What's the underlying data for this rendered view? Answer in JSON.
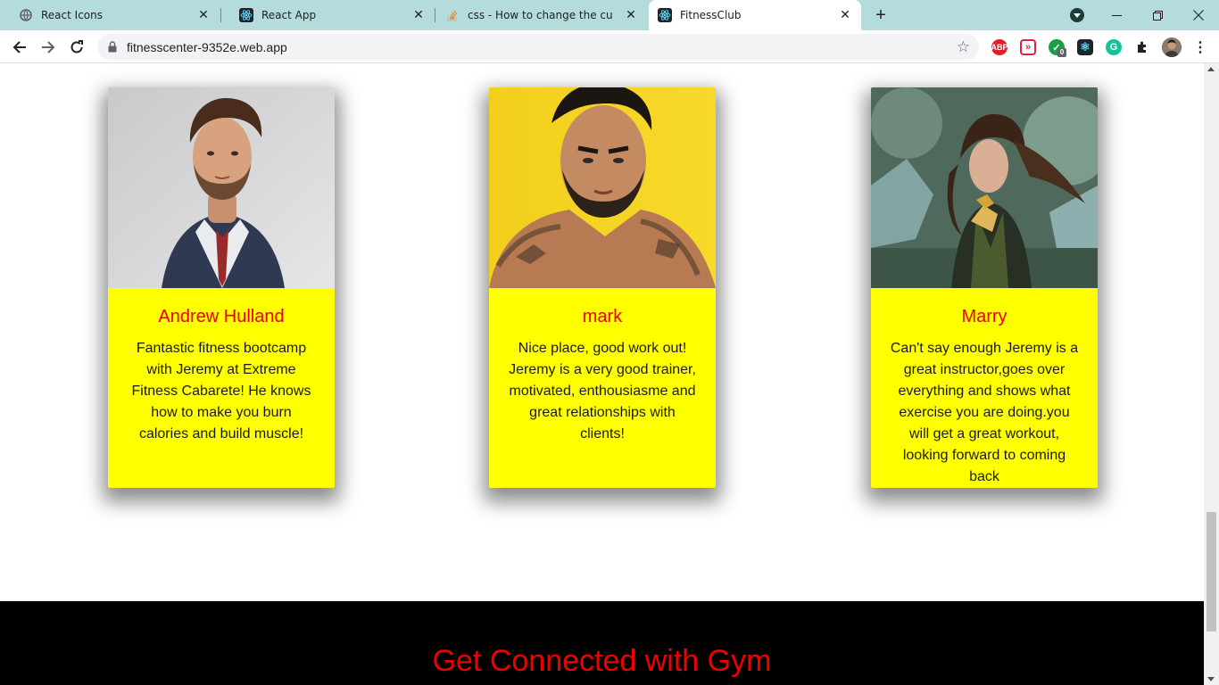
{
  "browser": {
    "tabs": [
      {
        "title": "React Icons",
        "favicon": "globe-icon"
      },
      {
        "title": "React App",
        "favicon": "react-icon"
      },
      {
        "title": "css - How to change the cursor in",
        "favicon": "stackoverflow-icon"
      },
      {
        "title": "FitnessClub",
        "favicon": "react-icon",
        "active": true
      }
    ],
    "url": "fitnesscenter-9352e.web.app",
    "extensions": [
      {
        "name": "adblock-plus-icon",
        "label": "ABP",
        "color": "#e41e26"
      },
      {
        "name": "redirect-extension-icon",
        "label": "»",
        "color": "#d7263d"
      },
      {
        "name": "checker-extension-icon",
        "label": "✓",
        "color": "#1b9e48",
        "badge": "0"
      },
      {
        "name": "react-devtools-icon",
        "label": "⚛",
        "color": "#20232a"
      },
      {
        "name": "grammarly-icon",
        "label": "G",
        "color": "#15c39a"
      },
      {
        "name": "extensions-puzzle-icon",
        "label": "",
        "color": "#202124"
      },
      {
        "name": "profile-avatar",
        "label": "",
        "color": "#6b5a4e"
      }
    ]
  },
  "testimonials": [
    {
      "name": "Andrew Hulland",
      "review": "Fantastic fitness bootcamp with Jeremy at Extreme Fitness Cabarete! He knows how to make you burn calories and build muscle!",
      "photo": "man-in-suit-photo"
    },
    {
      "name": "mark",
      "review": "Nice place, good work out! Jeremy is a very good trainer, motivated, enthousiasme and great relationships with clients!",
      "photo": "tattooed-man-photo"
    },
    {
      "name": "Marry",
      "review": "Can't say enough Jeremy is a great instructor,goes over everything and shows what exercise you are doing.you will get a great workout, looking forward to coming back",
      "photo": "woman-outdoors-photo"
    }
  ],
  "footer": {
    "heading": "Get Connected with Gym"
  },
  "colors": {
    "card_background": "#ffff00",
    "name_color": "#e8000f",
    "footer_background": "#000000",
    "footer_heading": "#ee0000",
    "tabbar": "#b4dcdc"
  }
}
